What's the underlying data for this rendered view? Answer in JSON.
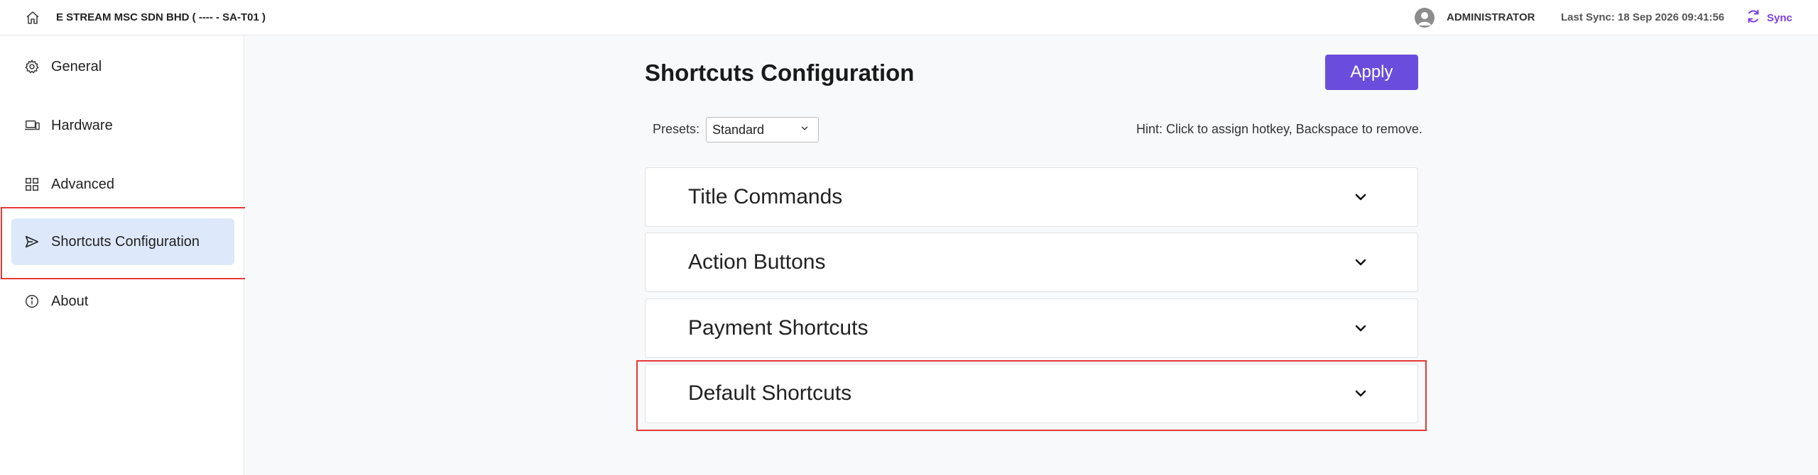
{
  "topbar": {
    "company": "E STREAM MSC SDN BHD ( ---- - SA-T01 )",
    "user": "ADMINISTRATOR",
    "last_sync": "Last Sync: 18 Sep 2026 09:41:56",
    "sync_label": "Sync"
  },
  "sidebar": {
    "items": [
      {
        "label": "General",
        "icon": "gear-icon"
      },
      {
        "label": "Hardware",
        "icon": "devices-icon"
      },
      {
        "label": "Advanced",
        "icon": "grid-icon"
      },
      {
        "label": "Shortcuts Configuration",
        "icon": "send-icon",
        "active": true
      },
      {
        "label": "About",
        "icon": "info-icon"
      }
    ]
  },
  "main": {
    "title": "Shortcuts Configuration",
    "apply_label": "Apply",
    "presets_label": "Presets:",
    "preset_value": "Standard",
    "hint": "Hint: Click to assign hotkey, Backspace to remove.",
    "sections": [
      {
        "title": "Title Commands"
      },
      {
        "title": "Action Buttons"
      },
      {
        "title": "Payment Shortcuts"
      },
      {
        "title": "Default Shortcuts"
      }
    ]
  },
  "colors": {
    "accent": "#6a4ddc",
    "sync": "#7b3fe4",
    "active_nav_bg": "#dde9fb",
    "highlight": "#e53935"
  }
}
